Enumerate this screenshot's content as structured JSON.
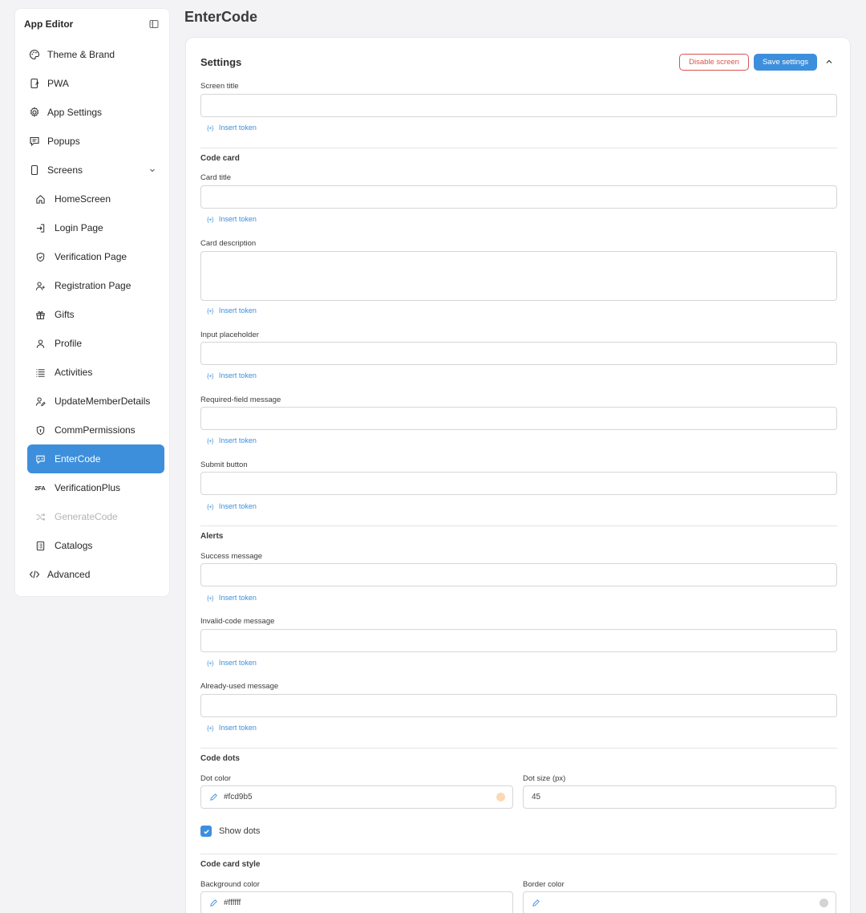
{
  "sidebar": {
    "title": "App Editor",
    "items": [
      {
        "label": "Theme & Brand",
        "icon": "palette-icon"
      },
      {
        "label": "PWA",
        "icon": "phone-link-icon"
      },
      {
        "label": "App Settings",
        "icon": "gear-icon"
      },
      {
        "label": "Popups",
        "icon": "popup-icon"
      },
      {
        "label": "Screens",
        "icon": "phone-icon",
        "expanded": true
      }
    ],
    "screens": [
      {
        "label": "HomeScreen",
        "icon": "home-icon"
      },
      {
        "label": "Login Page",
        "icon": "login-icon"
      },
      {
        "label": "Verification Page",
        "icon": "shield-check-icon"
      },
      {
        "label": "Registration Page",
        "icon": "user-plus-icon"
      },
      {
        "label": "Gifts",
        "icon": "gift-icon"
      },
      {
        "label": "Profile",
        "icon": "user-icon"
      },
      {
        "label": "Activities",
        "icon": "list-icon"
      },
      {
        "label": "UpdateMemberDetails",
        "icon": "user-edit-icon"
      },
      {
        "label": "CommPermissions",
        "icon": "shield-icon"
      },
      {
        "label": "EnterCode",
        "icon": "message-code-icon",
        "active": true
      },
      {
        "label": "VerificationPlus",
        "icon": "2fa-icon",
        "icon_text": "2FA"
      },
      {
        "label": "GenerateCode",
        "icon": "shuffle-icon",
        "disabled": true
      },
      {
        "label": "Catalogs",
        "icon": "catalog-icon"
      }
    ],
    "advanced": {
      "label": "Advanced",
      "icon": "code-icon"
    }
  },
  "page": {
    "title": "EnterCode"
  },
  "settings": {
    "title": "Settings",
    "disable_label": "Disable screen",
    "save_label": "Save settings",
    "token_label": "Insert token",
    "token_icon_text": "{+}",
    "screen_title_label": "Screen title",
    "code_card_heading": "Code card",
    "card_title_label": "Card title",
    "card_description_label": "Card description",
    "input_placeholder_label": "Input placeholder",
    "required_field_label": "Required-field message",
    "submit_button_label": "Submit button",
    "alerts_heading": "Alerts",
    "success_message_label": "Success message",
    "invalid_code_label": "Invalid-code message",
    "already_used_label": "Already-used message",
    "code_dots_heading": "Code dots",
    "dot_color_label": "Dot color",
    "dot_color_value": "#fcd9b5",
    "dot_size_label": "Dot size (px)",
    "dot_size_value": "45",
    "show_dots_label": "Show dots",
    "show_dots_checked": true,
    "code_card_style_heading": "Code card style",
    "background_color_label": "Background color",
    "background_color_value": "#ffffff",
    "border_color_label": "Border color",
    "border_color_value": ""
  },
  "colors": {
    "accent": "#3d8fdc",
    "danger": "#d9534f",
    "dot_swatch": "#fcd9b5",
    "border_swatch": "#d4d4d4"
  }
}
